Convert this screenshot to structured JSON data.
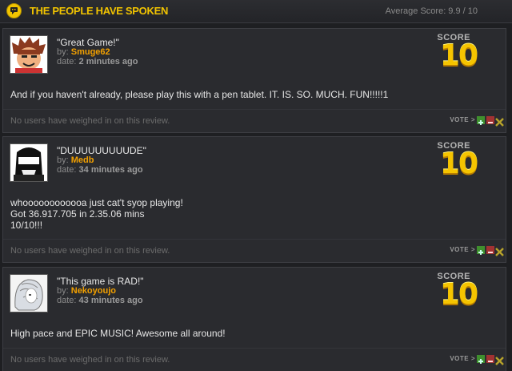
{
  "header": {
    "title": "THE PEOPLE HAVE SPOKEN",
    "average_score": "Average Score: 9.9 / 10"
  },
  "footer_labels": {
    "no_users": "No users have weighed in on this review.",
    "vote": "VOTE >"
  },
  "score_label": "SCORE",
  "reviews": [
    {
      "title": "\"Great Game!\"",
      "by_prefix": "by:",
      "user": "Smuge62",
      "date_prefix": "date:",
      "ago": "2 minutes ago",
      "score": "10",
      "body": "And if you haven't already, please play this with a pen tablet. IT. IS. SO. MUCH. FUN!!!!!1"
    },
    {
      "title": "\"DUUUUUUUUUDE\"",
      "by_prefix": "by:",
      "user": "Medb",
      "date_prefix": "date:",
      "ago": "34 minutes ago",
      "score": "10",
      "body": "whoooooooooooa just cat't syop playing!\nGot 36.917.705 in 2.35.06 mins\n10/10!!!"
    },
    {
      "title": "\"This game is RAD!\"",
      "by_prefix": "by:",
      "user": "Nekoyoujo",
      "date_prefix": "date:",
      "ago": "43 minutes ago",
      "score": "10",
      "body": "High pace and EPIC MUSIC! Awesome all around!"
    }
  ],
  "colors": {
    "accent": "#f2c400",
    "username": "#f2a000",
    "background": "#1e1f22",
    "panel": "#2a2b2f"
  }
}
